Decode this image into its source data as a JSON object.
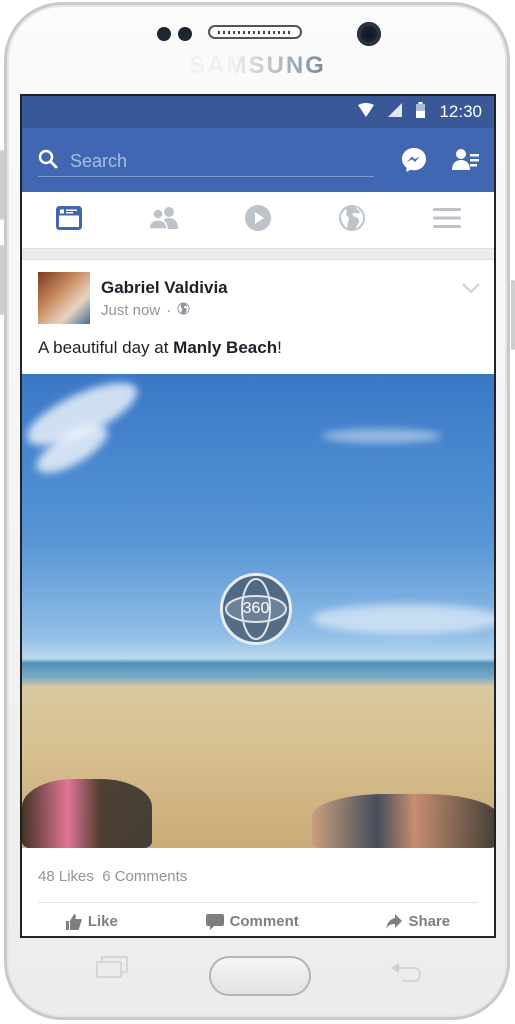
{
  "device": {
    "brand": "SAMSUNG"
  },
  "status_bar": {
    "time": "12:30",
    "icons": [
      "wifi-icon",
      "signal-icon",
      "battery-icon"
    ]
  },
  "app_bar": {
    "search_placeholder": "Search",
    "icons": [
      "messenger-icon",
      "friend-requests-icon"
    ]
  },
  "tabs": [
    {
      "name": "news-feed",
      "icon": "news-feed-icon",
      "active": true
    },
    {
      "name": "friends",
      "icon": "friends-icon",
      "active": false
    },
    {
      "name": "video",
      "icon": "video-play-icon",
      "active": false
    },
    {
      "name": "notifications",
      "icon": "globe-icon",
      "active": false
    },
    {
      "name": "menu",
      "icon": "hamburger-menu-icon",
      "active": false
    }
  ],
  "post": {
    "author": "Gabriel Valdivia",
    "time": "Just now",
    "separator": "·",
    "privacy": "public",
    "text_prefix": "A beautiful day at ",
    "text_place": "Manly Beach",
    "text_suffix": "!",
    "photo_badge": "360",
    "likes": "48 Likes",
    "comments": "6 Comments",
    "actions": {
      "like": "Like",
      "comment": "Comment",
      "share": "Share"
    }
  },
  "colors": {
    "brand_dark": "#385898",
    "brand": "#4267b2",
    "active_tab": "#4267b2",
    "inactive_tab": "#bec2c9"
  }
}
